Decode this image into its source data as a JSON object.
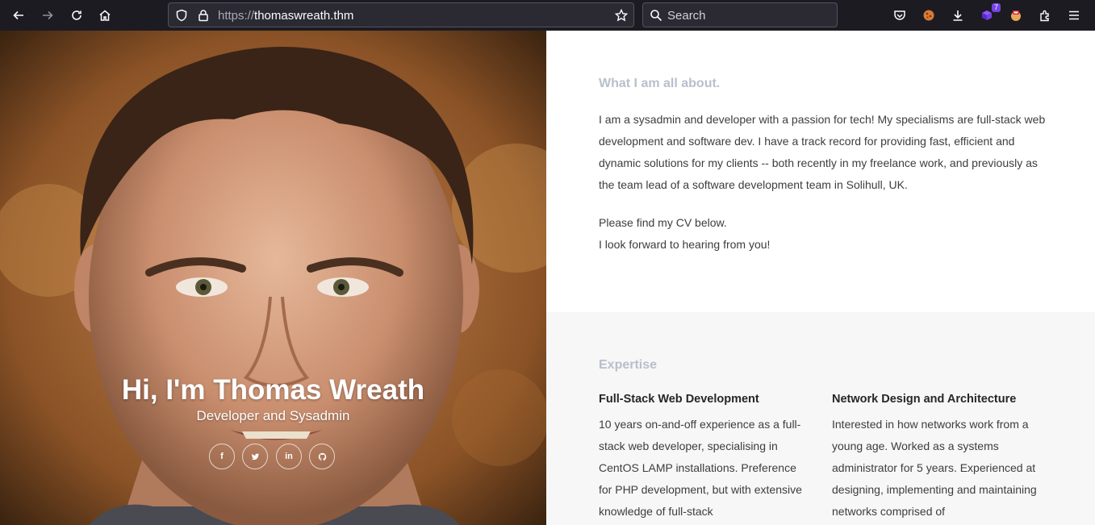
{
  "browser": {
    "url_protocol": "https://",
    "url_host": "thomaswreath.thm",
    "search_placeholder": "Search",
    "extension_badge": "7",
    "icons": [
      "back-icon",
      "forward-icon",
      "reload-icon",
      "home-icon",
      "shield-icon",
      "lock-icon",
      "star-icon",
      "search-icon",
      "pocket-icon",
      "extension-icon",
      "download-icon",
      "extensions-icon",
      "menu-icon"
    ]
  },
  "hero": {
    "title": "Hi, I'm Thomas Wreath",
    "subtitle": "Developer and Sysadmin",
    "socials": [
      "f",
      "t",
      "in",
      "gh"
    ]
  },
  "about": {
    "heading": "What I am all about.",
    "paragraph1": "I am a sysadmin and developer with a passion for tech! My specialisms are full-stack web development and software dev. I have a track record for providing fast, efficient and dynamic solutions for my clients -- both recently in my freelance work, and previously as the team lead of a software development team in Solihull, UK.",
    "paragraph2_line1": "Please find my CV below.",
    "paragraph2_line2": "I look forward to hearing from you!"
  },
  "expertise": {
    "heading": "Expertise",
    "items": [
      {
        "title": "Full-Stack Web Development",
        "text": "10 years on-and-off experience as a full-stack web developer, specialising in CentOS LAMP installations. Preference for PHP development, but with extensive knowledge of full-stack"
      },
      {
        "title": "Network Design and Architecture",
        "text": "Interested in how networks work from a young age. Worked as a systems administrator for 5 years. Experienced at designing, implementing and maintaining networks comprised of"
      }
    ]
  },
  "colors": {
    "toolbar": "#1c1b22",
    "urlbar": "#2b2a33",
    "section_heading": "#b8bfcc",
    "expertise_bg": "#f7f7f7"
  }
}
